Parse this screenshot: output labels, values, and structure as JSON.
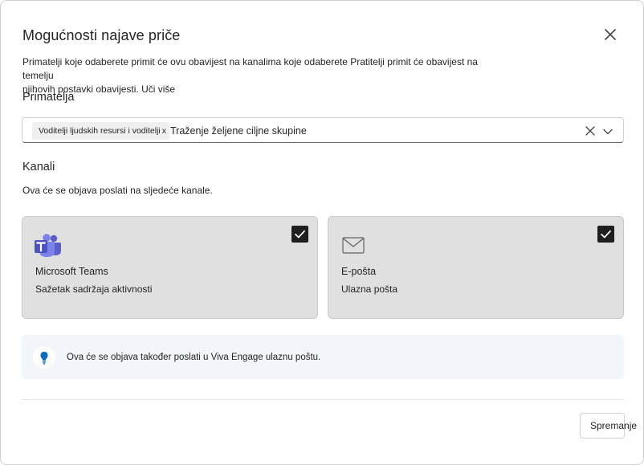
{
  "dialog": {
    "title": "Mogućnosti najave priče",
    "description_line1": "Primatelji koje odaberete primit će ovu obavijest na kanalima koje odaberete Pratitelji primit će obavijest na temelju",
    "description_line2": "njihovih postavki obavijesti.",
    "learn_more": "Uči više",
    "close_icon": "close-icon"
  },
  "recipients": {
    "label": "Primatelja",
    "chip_label": "Voditelji ljudskih resursi i voditelji",
    "chip_remove": "x",
    "search_text": "Traženje željene ciljne skupine",
    "clear_icon": "dismiss-icon",
    "dropdown_icon": "chevron-down-icon"
  },
  "channels": {
    "label": "Kanali",
    "subtitle": "Ova će se objava poslati na sljedeće kanale.",
    "cards": [
      {
        "name": "Microsoft Teams",
        "detail": "Sažetak sadržaja aktivnosti",
        "icon": "microsoft-teams-icon",
        "checked": true
      },
      {
        "name": "E-pošta",
        "detail": "Ulazna pošta",
        "icon": "mail-icon",
        "checked": true
      }
    ]
  },
  "info": {
    "text": "Ova će se objava također poslati u Viva Engage ulaznu poštu.",
    "icon": "lightbulb-icon"
  },
  "footer": {
    "save_label": "Spremanje"
  },
  "colors": {
    "accent": "#0f6cbd",
    "card_bg": "#e0e0e0",
    "info_bg": "#f2f5f9",
    "teams_purple": "#5b5fc7"
  }
}
